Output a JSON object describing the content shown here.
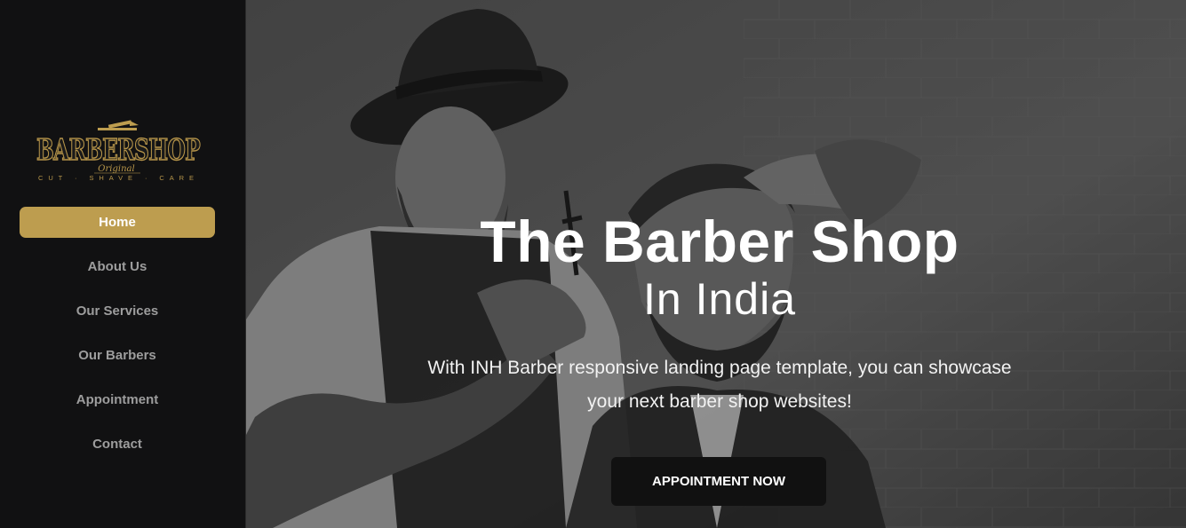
{
  "brand": {
    "logo_word": "BARBERSHOP",
    "logo_script": "Original",
    "logo_tagline": "CUT · SHAVE · CARE",
    "gold_color": "#bd9d4f"
  },
  "sidebar": {
    "items": [
      {
        "label": "Home",
        "active": true
      },
      {
        "label": "About Us",
        "active": false
      },
      {
        "label": "Our Services",
        "active": false
      },
      {
        "label": "Our Barbers",
        "active": false
      },
      {
        "label": "Appointment",
        "active": false
      },
      {
        "label": "Contact",
        "active": false
      }
    ]
  },
  "hero": {
    "title": "The Barber Shop",
    "subtitle": "In India",
    "text": "With INH Barber responsive landing page template, you can showcase your next barber shop websites!",
    "cta_label": "APPOINTMENT NOW"
  }
}
